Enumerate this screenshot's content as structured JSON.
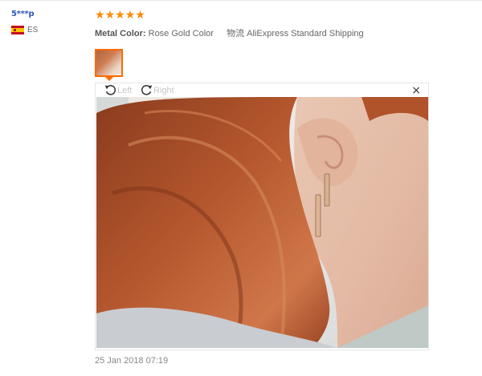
{
  "review": {
    "user_name": "5***p",
    "country_code": "ES",
    "rating": 5,
    "stars": [
      "★",
      "★",
      "★",
      "★",
      "★"
    ],
    "metal_color_label": "Metal Color:",
    "metal_color_value": "Rose Gold Color",
    "shipping_label": "物流",
    "shipping_value": "AliExpress Standard Shipping",
    "date": "25 Jan 2018 07:19"
  },
  "viewer": {
    "rotate_left_label": "Left",
    "rotate_right_label": "Right",
    "close_label": "×"
  },
  "icons": {
    "rotate_left": "rotate-left-icon",
    "rotate_right": "rotate-right-icon",
    "close": "close-icon"
  },
  "colors": {
    "star": "#ff8a00",
    "username": "#2b58b5",
    "thumb_border": "#ff6a00"
  }
}
